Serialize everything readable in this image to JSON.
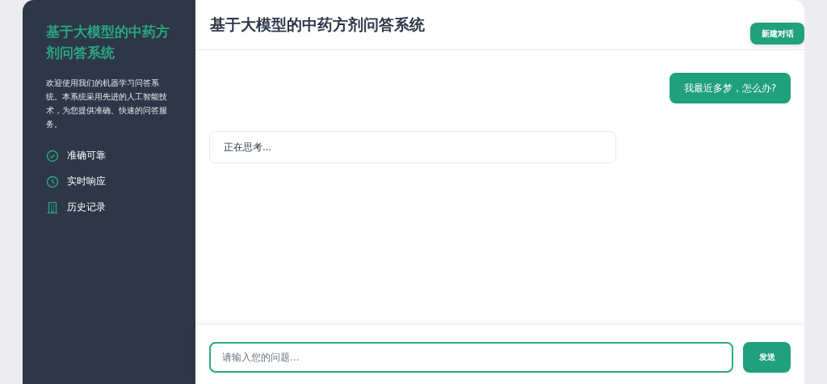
{
  "sidebar": {
    "title": "基于大模型的中药方剂问答系统",
    "description": "欢迎使用我们的机器学习问答系统。本系统采用先进的人工智能技术，为您提供准确、快速的问答服务。",
    "features": [
      {
        "kind": "check",
        "label": "准确可靠"
      },
      {
        "kind": "clock",
        "label": "实时响应"
      },
      {
        "kind": "building",
        "label": "历史记录"
      }
    ]
  },
  "header": {
    "title": "基于大模型的中药方剂问答系统",
    "new_chat_button": "新建对话"
  },
  "messages": [
    {
      "kind": "user",
      "text": "我最近多梦，怎么办?"
    },
    {
      "kind": "assistant",
      "text": "正在思考..."
    }
  ],
  "composer": {
    "placeholder": "请输入您的问题...",
    "send_button": "发送"
  }
}
